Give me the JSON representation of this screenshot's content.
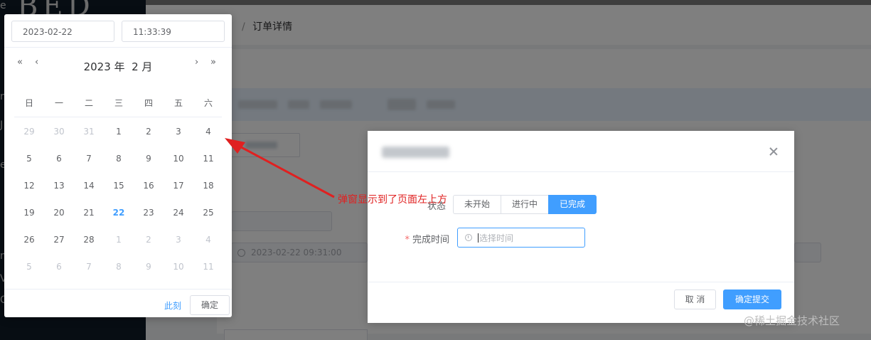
{
  "sidebar": {
    "logo_text": "BED ON",
    "edge_chars": [
      "e",
      "n",
      "J",
      "e",
      "n",
      "V",
      "C"
    ]
  },
  "page": {
    "breadcrumb_sep": "/",
    "breadcrumb_current": "订单详情",
    "bg_date_value": "2023-02-22 09:31:00"
  },
  "dialog": {
    "status_label": "状态",
    "status_options": [
      "未开始",
      "进行中",
      "已完成"
    ],
    "status_selected": "已完成",
    "completion_time_label": "完成时间",
    "completion_time_placeholder": "选择时间",
    "cancel_label": "取 消",
    "confirm_label": "确定提交"
  },
  "date_picker": {
    "date_value": "2023-02-22",
    "time_value": "11:33:39",
    "prev_year_icon": "«",
    "prev_month_icon": "‹",
    "next_month_icon": "›",
    "next_year_icon": "»",
    "year": "2023",
    "year_suffix": "年",
    "month": "2",
    "month_suffix": "月",
    "weekdays": [
      "日",
      "一",
      "二",
      "三",
      "四",
      "五",
      "六"
    ],
    "weeks": [
      [
        "29",
        "30",
        "31",
        "1",
        "2",
        "3",
        "4"
      ],
      [
        "5",
        "6",
        "7",
        "8",
        "9",
        "10",
        "11"
      ],
      [
        "12",
        "13",
        "14",
        "15",
        "16",
        "17",
        "18"
      ],
      [
        "19",
        "20",
        "21",
        "22",
        "23",
        "24",
        "25"
      ],
      [
        "26",
        "27",
        "28",
        "1",
        "2",
        "3",
        "4"
      ],
      [
        "5",
        "6",
        "7",
        "8",
        "9",
        "10",
        "11"
      ]
    ],
    "today": "22",
    "now_label": "此刻",
    "ok_label": "确定"
  },
  "annotation": {
    "text": "弹窗显示到了页面左上方",
    "color": "#e02020"
  },
  "watermark": "@稀土掘金技术社区",
  "colors": {
    "primary": "#409eff",
    "required": "#f56c6c",
    "sidebar_bg": "#0f1a27"
  }
}
